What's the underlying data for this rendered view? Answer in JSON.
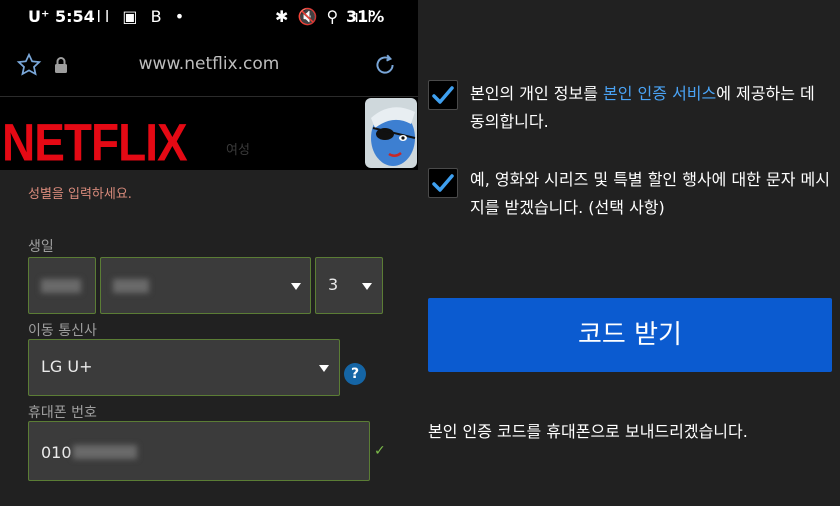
{
  "status_bar": {
    "time": "5:54",
    "carrier": "U⁺",
    "left_icons": "ıll ▣ B •",
    "right_icons": "✱ 🔇 ⚲ .ıll",
    "battery": "31%"
  },
  "browser": {
    "url": "www.netflix.com",
    "icons": [
      "star-icon",
      "lock-icon",
      "reload-icon"
    ]
  },
  "header": {
    "logo": "NETFLIX",
    "faded_text": "여성"
  },
  "form": {
    "gender_hint": "성별을 입력하세요.",
    "birthday_label": "생일",
    "day_value": "3",
    "carrier_label": "이동 통신사",
    "carrier_value": "LG U+",
    "help_icon": "?",
    "phone_label": "휴대폰 번호",
    "phone_prefix": "010",
    "valid_mark": "✓"
  },
  "consents": [
    {
      "checked": true,
      "before": "본인의 개인 정보를 ",
      "link": "본인 인증 서비스",
      "after": "에 제공하는 데 동의합니다."
    },
    {
      "checked": true,
      "text": "예, 영화와 시리즈 및 특별 할인 행사에 대한 문자 메시지를 받겠습니다. (선택 사항)"
    }
  ],
  "actions": {
    "get_code": "코드 받기"
  },
  "note": "본인 인증 코드를 휴대폰으로 보내드리겠습니다.",
  "colors": {
    "brand": "#e50914",
    "primary_button": "#0b5bd0",
    "link": "#4aa3f4",
    "checkmark": "#3fa0f0",
    "valid_border": "#5b7d35"
  }
}
